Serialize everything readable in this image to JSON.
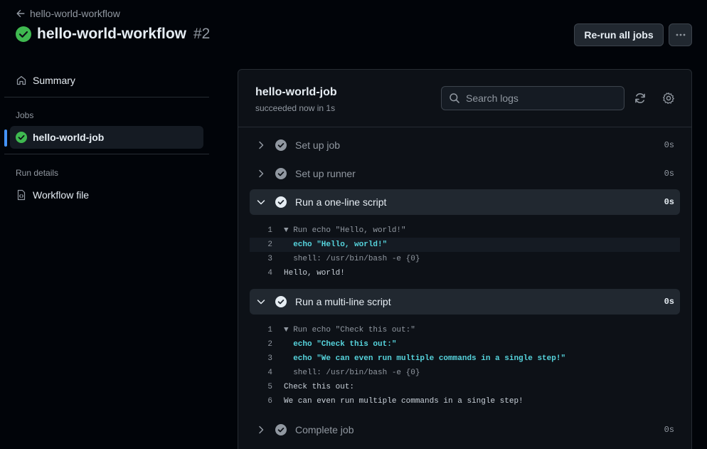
{
  "header": {
    "back_label": "hello-world-workflow",
    "run_title": "hello-world-workflow",
    "run_number": "#2",
    "rerun_label": "Re-run all jobs"
  },
  "sidebar": {
    "summary_label": "Summary",
    "jobs_heading": "Jobs",
    "job_label": "hello-world-job",
    "run_details_heading": "Run details",
    "workflow_file_label": "Workflow file"
  },
  "job": {
    "title": "hello-world-job",
    "subtitle": "succeeded now in 1s",
    "search_placeholder": "Search logs"
  },
  "steps": {
    "s1": {
      "label": "Set up job",
      "duration": "0s"
    },
    "s2": {
      "label": "Set up runner",
      "duration": "0s"
    },
    "s3": {
      "label": "Run a one-line script",
      "duration": "0s",
      "lines": [
        {
          "num": "1",
          "text": "▼ Run echo \"Hello, world!\""
        },
        {
          "num": "2",
          "text": "  echo \"Hello, world!\""
        },
        {
          "num": "3",
          "text": "  shell: /usr/bin/bash -e {0}"
        },
        {
          "num": "4",
          "text": "Hello, world!"
        }
      ]
    },
    "s4": {
      "label": "Run a multi-line script",
      "duration": "0s",
      "lines": [
        {
          "num": "1",
          "text": "▼ Run echo \"Check this out:\""
        },
        {
          "num": "2",
          "text": "  echo \"Check this out:\""
        },
        {
          "num": "3",
          "text": "  echo \"We can even run multiple commands in a single step!\""
        },
        {
          "num": "4",
          "text": "  shell: /usr/bin/bash -e {0}"
        },
        {
          "num": "5",
          "text": "Check this out:"
        },
        {
          "num": "6",
          "text": "We can even run multiple commands in a single step!"
        }
      ]
    },
    "s5": {
      "label": "Complete job",
      "duration": "0s"
    }
  },
  "colors": {
    "success": "#3fb950",
    "accent": "#4493f8",
    "command": "#56d4dd"
  },
  "icons": {
    "back": "arrow-left-icon",
    "status": "check-circle-fill-icon",
    "summary": "home-icon",
    "workflow_file": "file-code-icon",
    "search": "search-icon",
    "refresh": "sync-icon",
    "settings": "gear-icon",
    "more": "kebab-horizontal-icon"
  }
}
